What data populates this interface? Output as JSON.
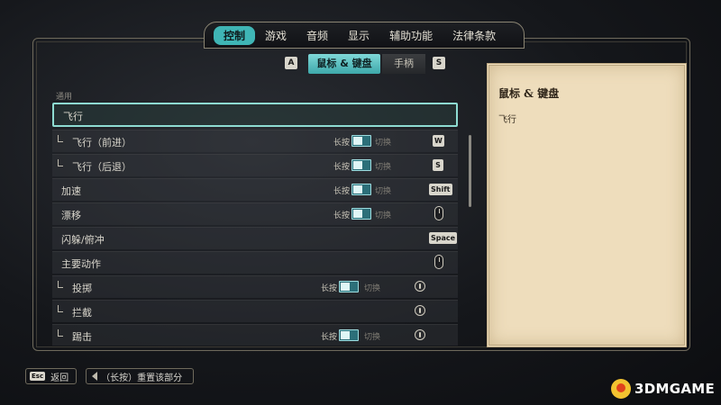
{
  "top_tabs": [
    "控制",
    "游戏",
    "音频",
    "显示",
    "辅助功能",
    "法律条款"
  ],
  "sub_tabs": {
    "left_key": "A",
    "right_key": "S",
    "mouse_keyboard": "鼠标 & 键盘",
    "controller": "手柄"
  },
  "section_label": "通用",
  "rows": [
    {
      "label": "飞行",
      "selected": true
    },
    {
      "label": "飞行（前进）",
      "hold": "长按",
      "switch": "切换",
      "key": "W"
    },
    {
      "label": "飞行（后退）",
      "hold": "长按",
      "switch": "切换",
      "key": "S"
    },
    {
      "label": "加速",
      "hold": "长按",
      "switch": "切换",
      "key": "Shift"
    },
    {
      "label": "漂移",
      "hold": "长按",
      "switch": "切换",
      "key_icon": "mouse-right-icon"
    },
    {
      "label": "闪躲/俯冲",
      "key": "Space"
    },
    {
      "label": "主要动作",
      "key_icon": "mouse-left-icon"
    },
    {
      "label": "投掷",
      "hold": "长按",
      "switch": "切换",
      "key_icon": "mouse-wheel-icon"
    },
    {
      "label": "拦截",
      "key_icon": "mouse-wheel-icon"
    },
    {
      "label": "踢击",
      "hold": "长按",
      "switch": "切换",
      "key_icon": "mouse-wheel-icon"
    }
  ],
  "detail": {
    "title": "鼠标 & 键盘",
    "text": "飞行"
  },
  "bottom": {
    "back_key": "Esc",
    "back_label": "返回",
    "reset_label": "（长按）重置该部分"
  },
  "watermark": "3DMGAME",
  "colors": {
    "accent": "#3fb5b5",
    "parchment": "#eeddbc",
    "highlight_border": "#8edcd2"
  }
}
